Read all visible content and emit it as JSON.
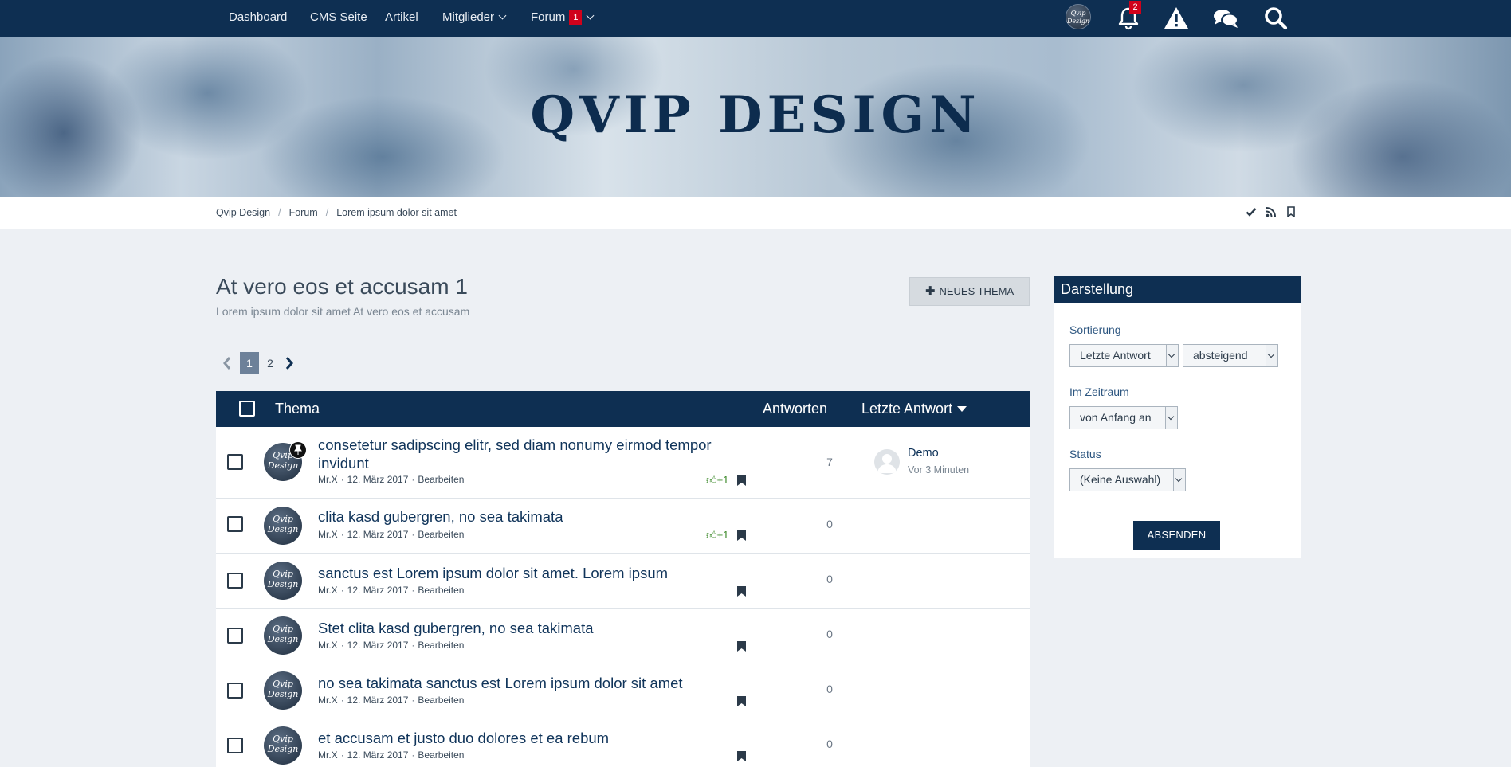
{
  "nav": {
    "items": [
      {
        "label": "Dashboard"
      },
      {
        "label": "CMS Seite"
      },
      {
        "label": "Artikel"
      },
      {
        "label": "Mitglieder"
      },
      {
        "label": "Forum",
        "badge": "1"
      }
    ],
    "avatar_text": "Qvip Design",
    "notification_count": "2",
    "icons": [
      "bell-icon",
      "warning-icon",
      "chat-icon",
      "search-icon"
    ]
  },
  "hero": {
    "title": "QVIP DESIGN"
  },
  "breadcrumb": {
    "items": [
      "Qvip Design",
      "Forum",
      "Lorem ipsum dolor sit amet"
    ],
    "separator": "/",
    "icons": [
      "check-icon",
      "rss-icon",
      "bookmark-icon"
    ]
  },
  "page": {
    "title": "At vero eos et accusam 1",
    "subtitle": "Lorem ipsum dolor sit amet At vero eos et accusam",
    "new_thread_label": "NEUES THEMA"
  },
  "pagination": {
    "pages": [
      "1",
      "2"
    ],
    "current": "1"
  },
  "table": {
    "headers": {
      "topic": "Thema",
      "replies": "Antworten",
      "last_reply": "Letzte Antwort"
    },
    "rows": [
      {
        "title": "consetetur sadipscing elitr, sed diam nonumy eirmod tempor invidunt",
        "author": "Mr.X",
        "date": "12. März 2017",
        "edit": "Bearbeiten",
        "likes": "+1",
        "replies": "7",
        "pinned": true,
        "last_user": "Demo",
        "last_time": "Vor 3 Minuten"
      },
      {
        "title": "clita kasd gubergren, no sea takimata",
        "author": "Mr.X",
        "date": "12. März 2017",
        "edit": "Bearbeiten",
        "likes": "+1",
        "replies": "0"
      },
      {
        "title": "sanctus est Lorem ipsum dolor sit amet. Lorem ipsum",
        "author": "Mr.X",
        "date": "12. März 2017",
        "edit": "Bearbeiten",
        "replies": "0"
      },
      {
        "title": "Stet clita kasd gubergren, no sea takimata",
        "author": "Mr.X",
        "date": "12. März 2017",
        "edit": "Bearbeiten",
        "replies": "0"
      },
      {
        "title": "no sea takimata sanctus est Lorem ipsum dolor sit amet",
        "author": "Mr.X",
        "date": "12. März 2017",
        "edit": "Bearbeiten",
        "replies": "0"
      },
      {
        "title": "et accusam et justo duo dolores et ea rebum",
        "author": "Mr.X",
        "date": "12. März 2017",
        "edit": "Bearbeiten",
        "replies": "0"
      }
    ]
  },
  "sidebar": {
    "title": "Darstellung",
    "sort_label": "Sortierung",
    "sort_value": "Letzte Antwort",
    "order_value": "absteigend",
    "period_label": "Im Zeitraum",
    "period_value": "von Anfang an",
    "status_label": "Status",
    "status_value": "(Keine Auswahl)",
    "submit_label": "ABSENDEN"
  },
  "colors": {
    "primary": "#0e2f52",
    "badge": "#d0021b",
    "like": "#3c8a2a",
    "page_bg": "#edf0f4"
  }
}
